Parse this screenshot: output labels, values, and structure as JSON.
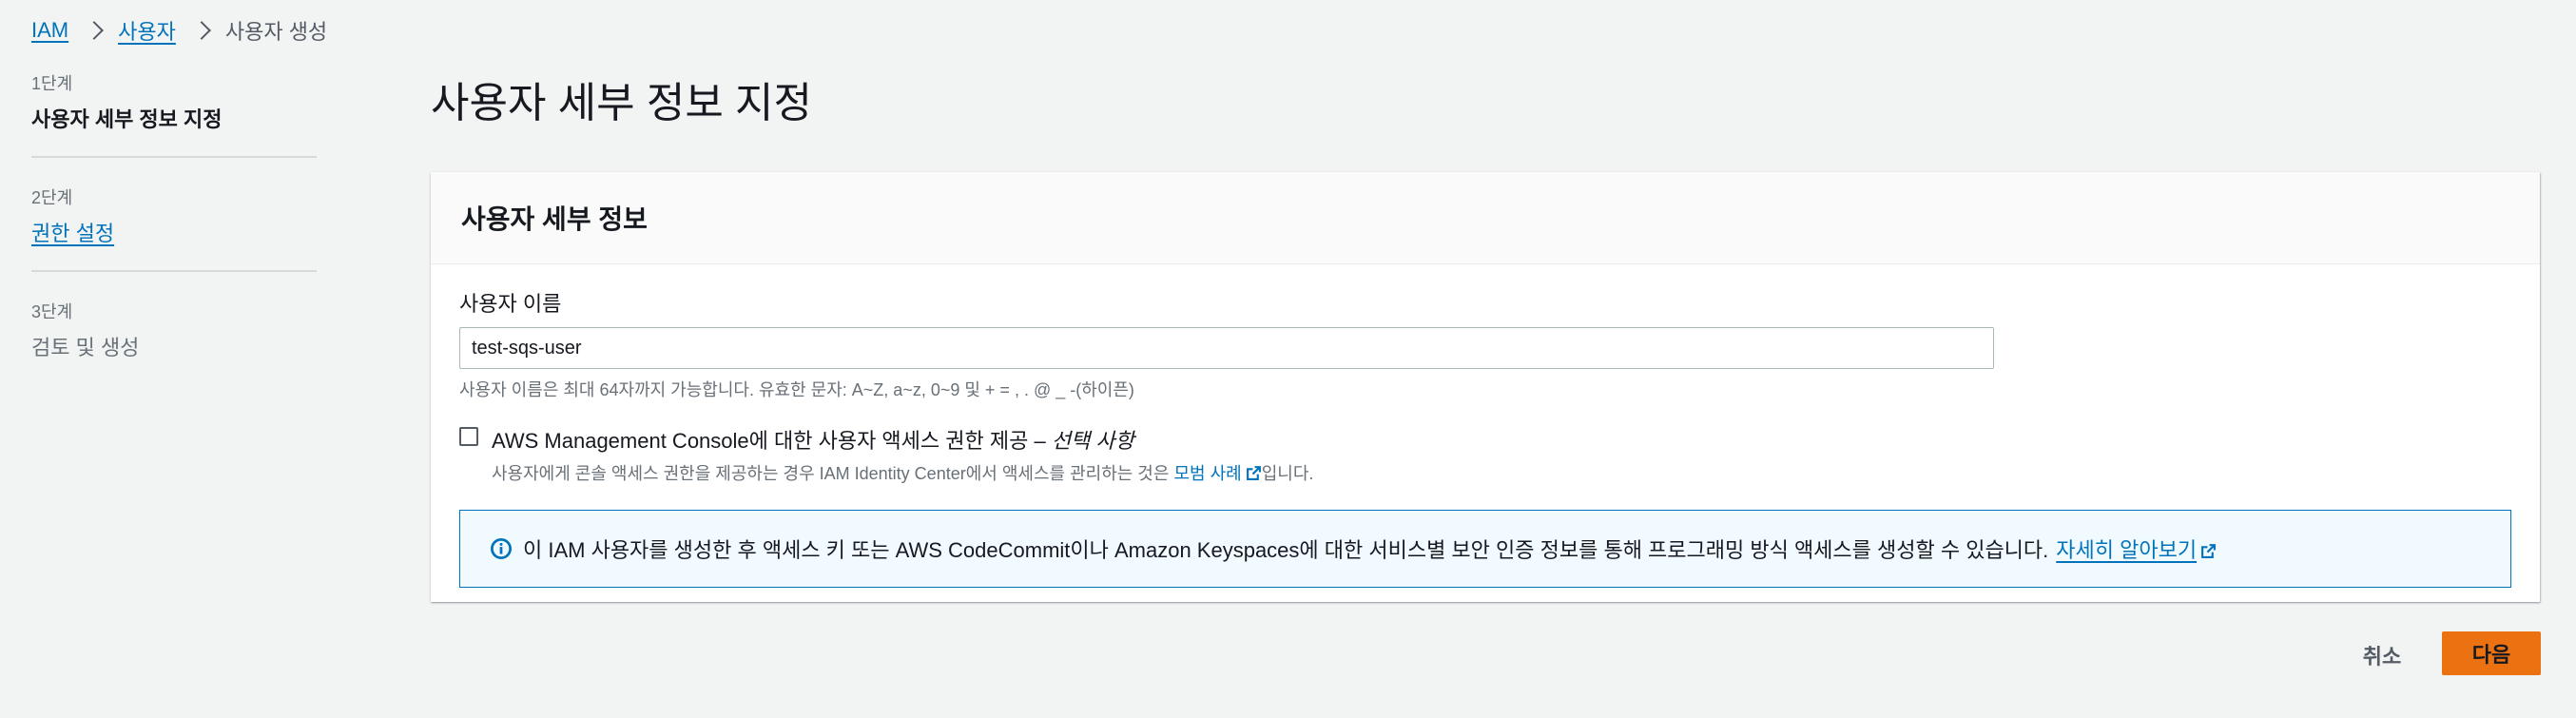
{
  "breadcrumb": {
    "root": "IAM",
    "users": "사용자",
    "current": "사용자 생성"
  },
  "steps": [
    {
      "number": "1단계",
      "title": "사용자 세부 정보 지정"
    },
    {
      "number": "2단계",
      "title": "권한 설정"
    },
    {
      "number": "3단계",
      "title": "검토 및 생성"
    }
  ],
  "page": {
    "title": "사용자 세부 정보 지정"
  },
  "panel": {
    "title": "사용자 세부 정보",
    "username_label": "사용자 이름",
    "username_value": "test-sqs-user",
    "username_hint": "사용자 이름은 최대 64자까지 가능합니다. 유효한 문자: A~Z, a~z, 0~9 및 + = , . @ _ -(하이픈)",
    "console_access_label": "AWS Management Console에 대한 사용자 액세스 권한 제공 –",
    "console_access_optional": "선택 사항",
    "console_access_checked": false,
    "console_desc_prefix": "사용자에게 콘솔 액세스 권한을 제공하는 경우 IAM Identity Center에서 액세스를 관리하는 것은",
    "console_desc_link": "모범 사례",
    "console_desc_suffix": "입니다.",
    "info_text": "이 IAM 사용자를 생성한 후 액세스 키 또는 AWS CodeCommit이나 Amazon Keyspaces에 대한 서비스별 보안 인증 정보를 통해 프로그래밍 방식 액세스를 생성할 수 있습니다.",
    "info_link": "자세히 알아보기"
  },
  "actions": {
    "cancel": "취소",
    "next": "다음"
  },
  "icons": {
    "breadcrumb_separator": "chevron-right-icon",
    "info": "info-icon",
    "external_link": "external-link-icon"
  },
  "colors": {
    "link": "#0073bb",
    "primary_button": "#ec7211",
    "background": "#f2f3f3",
    "info_border": "#0073bb"
  }
}
